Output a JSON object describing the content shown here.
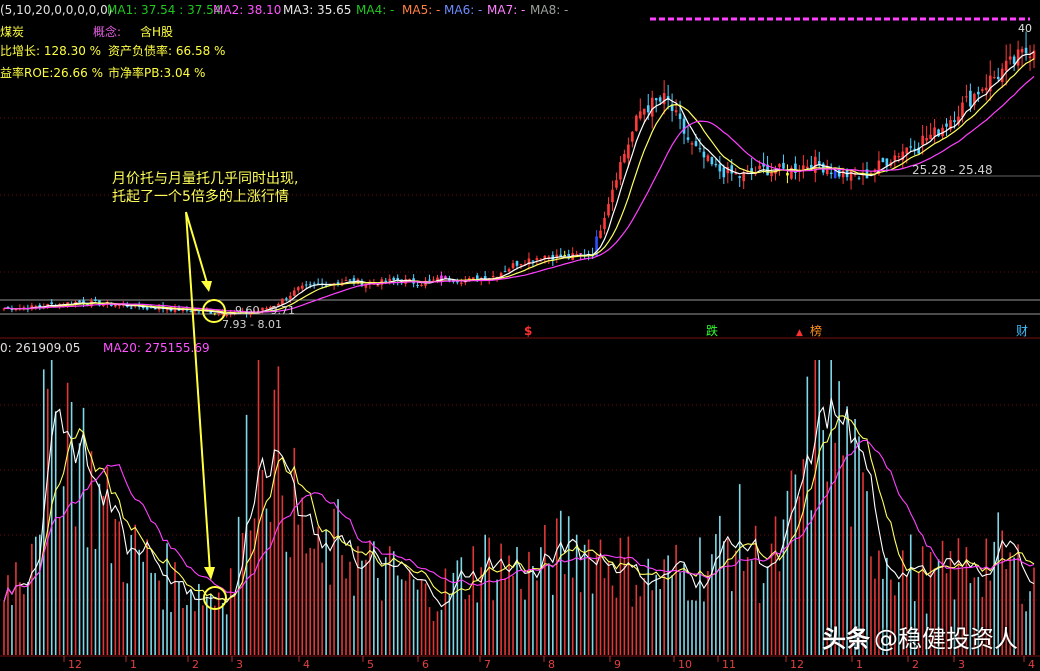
{
  "header": {
    "ma_param": "(5,10,20,0,0,0,0,0)",
    "ma_items": [
      {
        "label": "MA1: 37.54 : 37.54",
        "color": "#21c621"
      },
      {
        "label": "MA2: 38.10",
        "color": "#ff54ff"
      },
      {
        "label": "MA3: 35.65",
        "color": "#e8e8e8"
      },
      {
        "label": "MA4: -",
        "color": "#21c621"
      },
      {
        "label": "MA5: -",
        "color": "#ff8040"
      },
      {
        "label": "MA6: -",
        "color": "#6f8cff"
      },
      {
        "label": "MA7: -",
        "color": "#ff80ff"
      },
      {
        "label": "MA8: -",
        "color": "#9aa09a"
      }
    ]
  },
  "info": {
    "industry": "煤炭",
    "concept_label": "概念:",
    "concept_value": "含H股",
    "growth": "比增长: 128.30 %",
    "debt_ratio": "资产负债率: 66.58 %",
    "roe": "益率ROE:26.66 %",
    "pb": "市净率PB:3.04 %"
  },
  "annotation": {
    "line1": "月价托与月量托几乎同时出现,",
    "line2": "托起了一个5倍多的上涨行情"
  },
  "price_labels": {
    "high": "40",
    "range_top": "25.28 - 25.48",
    "range_mid": "9.60 - 9.71",
    "range_low": "7.93 - 8.01"
  },
  "event_markers": [
    {
      "text": "$",
      "color": "#ff3030"
    },
    {
      "text": "跌",
      "color": "#30ff30"
    },
    {
      "text": "▲",
      "color": "#ff3030"
    },
    {
      "text": "榜",
      "color": "#ff9020"
    },
    {
      "text": "财",
      "color": "#40c0ff"
    }
  ],
  "volume_header": {
    "vol_ma10": "0: 261909.05",
    "vol_ma20": "MA20: 275155.69"
  },
  "x_axis_ticks": [
    "12",
    "1",
    "2",
    "3",
    "4",
    "5",
    "6",
    "7",
    "8",
    "9",
    "10",
    "11",
    "12",
    "1",
    "2",
    "3",
    "4"
  ],
  "watermark": {
    "logo": "头条",
    "text": "@稳健投资人"
  },
  "chart_data": [
    {
      "type": "candlestick",
      "title": "",
      "moving_averages": [
        "MA5",
        "MA10",
        "MA20"
      ],
      "close_trend": [
        8.5,
        8.6,
        8.9,
        9.2,
        9.0,
        8.8,
        8.6,
        8.4,
        8.2,
        8.0,
        7.95,
        8.8,
        10.6,
        11.2,
        11.5,
        11.2,
        11.6,
        11.3,
        11.8,
        11.6,
        12.1,
        13.6,
        14.3,
        14.1,
        14.6,
        23.5,
        30.5,
        31.5,
        26.5,
        23.8,
        23.0,
        23.8,
        23.6,
        24.6,
        23.4,
        22.9,
        24.8,
        26.5,
        27.8,
        30.5,
        33.2,
        35.2,
        37.5
      ],
      "price_axis_high": 40,
      "support_ranges": [
        "25.28 - 25.48",
        "9.60 - 9.71",
        "7.93 - 8.01"
      ]
    },
    {
      "type": "bar",
      "title": "",
      "series": [
        {
          "name": "MA20",
          "latest": 275155.69
        },
        {
          "name": "MA10",
          "latest": 261909.05
        }
      ],
      "volume_trend": [
        0.25,
        0.3,
        0.75,
        0.85,
        0.6,
        0.45,
        0.35,
        0.3,
        0.25,
        0.22,
        0.2,
        0.28,
        0.85,
        0.7,
        0.45,
        0.3,
        0.38,
        0.3,
        0.28,
        0.25,
        0.2,
        0.22,
        0.28,
        0.32,
        0.3,
        0.28,
        0.32,
        0.38,
        0.35,
        0.32,
        0.28,
        0.25,
        0.28,
        0.3,
        0.35,
        0.4,
        0.3,
        0.35,
        0.6,
        0.95,
        0.7,
        0.45,
        0.35,
        0.3,
        0.25,
        0.28,
        0.3,
        0.35,
        0.3,
        0.25
      ]
    }
  ]
}
